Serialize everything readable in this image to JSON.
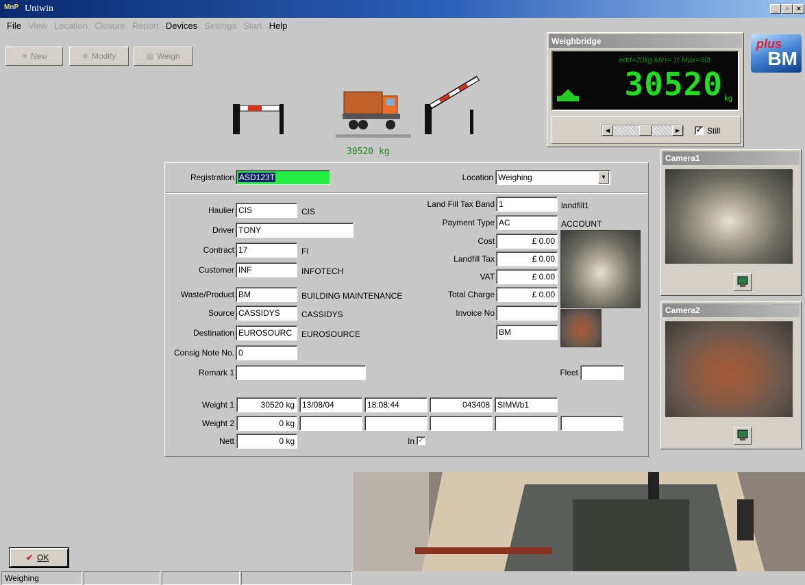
{
  "window": {
    "title": "Uniwin",
    "app_icon_text": "MnP"
  },
  "menu": [
    {
      "label": "File",
      "enabled": true
    },
    {
      "label": "View",
      "enabled": false
    },
    {
      "label": "Location",
      "enabled": false
    },
    {
      "label": "Closure",
      "enabled": false
    },
    {
      "label": "Report",
      "enabled": false
    },
    {
      "label": "Devices",
      "enabled": true
    },
    {
      "label": "Settings",
      "enabled": false
    },
    {
      "label": "Start",
      "enabled": false
    },
    {
      "label": "Help",
      "enabled": true
    }
  ],
  "toolbar": {
    "new_label": "New",
    "modify_label": "Modify",
    "weigh_label": "Weigh"
  },
  "scene": {
    "truck_weight": "30520 kg"
  },
  "weighbridge": {
    "title": "Weighbridge",
    "limits": "edd=20kg  Min= 1t  Max=50t",
    "reading": "30520",
    "unit": "kg",
    "still_label": "Still",
    "still_checked": true
  },
  "logo": {
    "top_text": "plus",
    "bottom_text": "BM"
  },
  "cameras": {
    "cam1_title": "Camera1",
    "cam2_title": "Camera2"
  },
  "form": {
    "registration_label": "Registration",
    "registration_value": "ASD123T",
    "location_label": "Location",
    "location_value": "Weighing",
    "haulier_label": "Haulier",
    "haulier_value": "CIS",
    "haulier_name": "CIS",
    "driver_label": "Driver",
    "driver_value": "TONY",
    "contract_label": "Contract",
    "contract_value": "17",
    "contract_name": "FI",
    "customer_label": "Customer",
    "customer_value": "INF",
    "customer_name": "INFOTECH",
    "waste_label": "Waste/Product",
    "waste_value": "BM",
    "waste_name": "BUILDING MAINTENANCE",
    "source_label": "Source",
    "source_value": "CASSIDYS",
    "source_name": "CASSIDYS",
    "destination_label": "Destination",
    "destination_value": "EUROSOURC",
    "destination_name": "EUROSOURCE",
    "consig_label": "Consig Note No.",
    "consig_value": "0",
    "remark_label": "Remark 1",
    "remark_value": "",
    "landfill_band_label": "Land Fill Tax Band",
    "landfill_band_value": "1",
    "landfill_band_name": "landfill1",
    "payment_label": "Payment Type",
    "payment_value": "AC",
    "payment_name": "ACCOUNT",
    "cost_label": "Cost",
    "cost_value": "£ 0.00",
    "landfill_tax_label": "Landfill Tax",
    "landfill_tax_value": "£ 0.00",
    "vat_label": "VAT",
    "vat_value": "£ 0.00",
    "total_label": "Total Charge",
    "total_value": "£ 0.00",
    "invoice_label": "Invoice No",
    "invoice_value": "",
    "extra_value": "BM",
    "fleet_label": "Fleet",
    "fleet_value": "",
    "weight1_label": "Weight 1",
    "weight1_value": "30520 kg",
    "weight1_date": "13/08/04",
    "weight1_time": "18:08:44",
    "weight1_ticket": "043408",
    "weight1_bridge": "SIMWb1",
    "weight2_label": "Weight 2",
    "weight2_value": "0 kg",
    "nett_label": "Nett",
    "nett_value": "0 kg",
    "in_label": "In",
    "in_checked": true
  },
  "ok_label": "OK",
  "status": {
    "mode": "Weighing"
  }
}
